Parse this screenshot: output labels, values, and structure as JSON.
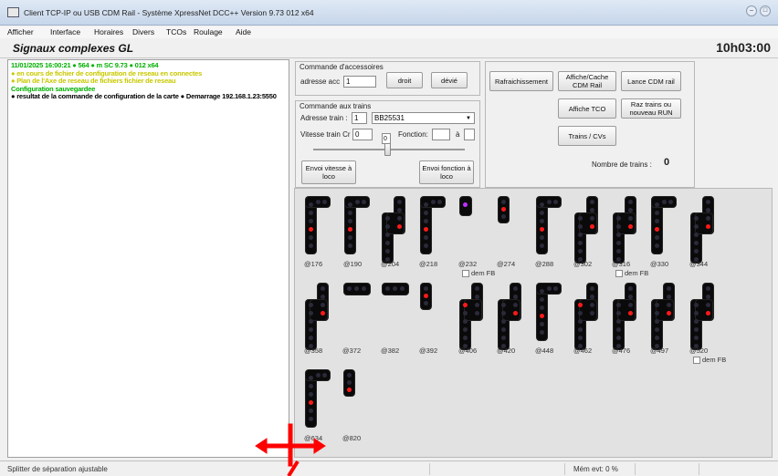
{
  "window": {
    "title": "Client TCP-IP ou USB CDM Rail - Système XpressNet DCC++ Version 9.73  012 x64"
  },
  "menu": [
    "Afficher",
    "Interface",
    "Horaires",
    "Divers",
    "TCOs",
    "Roulage",
    "Aide"
  ],
  "page": {
    "title": "Signaux complexes GL",
    "clock": "10h03:00"
  },
  "log": [
    {
      "text": "11/01/2025 16:00:21 ● 564 ● m SC 9.73 ● 012 x64",
      "color": "#00b000"
    },
    {
      "text": "● en cours de fichier de configuration de reseau en connectes",
      "color": "#c8c800"
    },
    {
      "text": "● Plan de l'Axe de reseau de fichiers fichier de reseau",
      "color": "#c8c800"
    },
    {
      "text": "Configuration sauvegardee",
      "color": "#00b000"
    },
    {
      "text": "● resultat de la commande de configuration de la carte ● Demarrage 192.168.1.23:5550",
      "color": "#000000"
    }
  ],
  "accessories": {
    "group_title": "Commande d'accessoires",
    "address_label": "adresse acc",
    "address_value": "1",
    "droit_button": "droit",
    "devie_button": "dévié"
  },
  "trains": {
    "group_title": "Commande aux trains",
    "address_label": "Adresse train :",
    "address_value": "1",
    "train_select": "BB25531",
    "speed_label": "Vitesse train Cr",
    "speed_value": "0",
    "slider_value": "0",
    "function_label": "Fonction:",
    "function_value": "",
    "to_label": "à",
    "to_value": "",
    "send_speed_button": "Envoi vitesse à loco",
    "send_function_button": "Envoi fonction à loco"
  },
  "right_panel": {
    "refresh_button": "Rafraichissement",
    "toggle_rail_button": "Affiche/Cache CDM Rail",
    "launch_cdm_button": "Lance CDM rail",
    "show_tco_button": "Affiche TCO",
    "reset_trains_button": "Raz trains ou nouveau RUN",
    "trains_cv_button": "Trains / CVs",
    "train_count_label": "Nombre de trains :",
    "train_count_value": "0"
  },
  "signals": [
    {
      "label": "@176"
    },
    {
      "label": "@190"
    },
    {
      "label": "@204"
    },
    {
      "label": "@218"
    },
    {
      "label": "@232",
      "dem_fb": "dem FB"
    },
    {
      "label": "@274"
    },
    {
      "label": "@288"
    },
    {
      "label": "@302"
    },
    {
      "label": "@316",
      "dem_fb": "dem FB"
    },
    {
      "label": "@330"
    },
    {
      "label": "@344"
    },
    {
      "label": "@358"
    },
    {
      "label": "@372"
    },
    {
      "label": "@382"
    },
    {
      "label": "@392"
    },
    {
      "label": "@406"
    },
    {
      "label": "@420"
    },
    {
      "label": "@448"
    },
    {
      "label": "@462"
    },
    {
      "label": "@476"
    },
    {
      "label": "@497"
    },
    {
      "label": "@520",
      "dem_fb": "dem FB"
    },
    {
      "label": "@634"
    },
    {
      "label": "@820"
    }
  ],
  "status": {
    "left": "Splitter de séparation ajustable",
    "mem": "Mém evt: 0 %"
  },
  "colors": {
    "red_light": "#ff1a1a",
    "magenta_light": "#c030ff",
    "cursor": "#ff0000"
  }
}
